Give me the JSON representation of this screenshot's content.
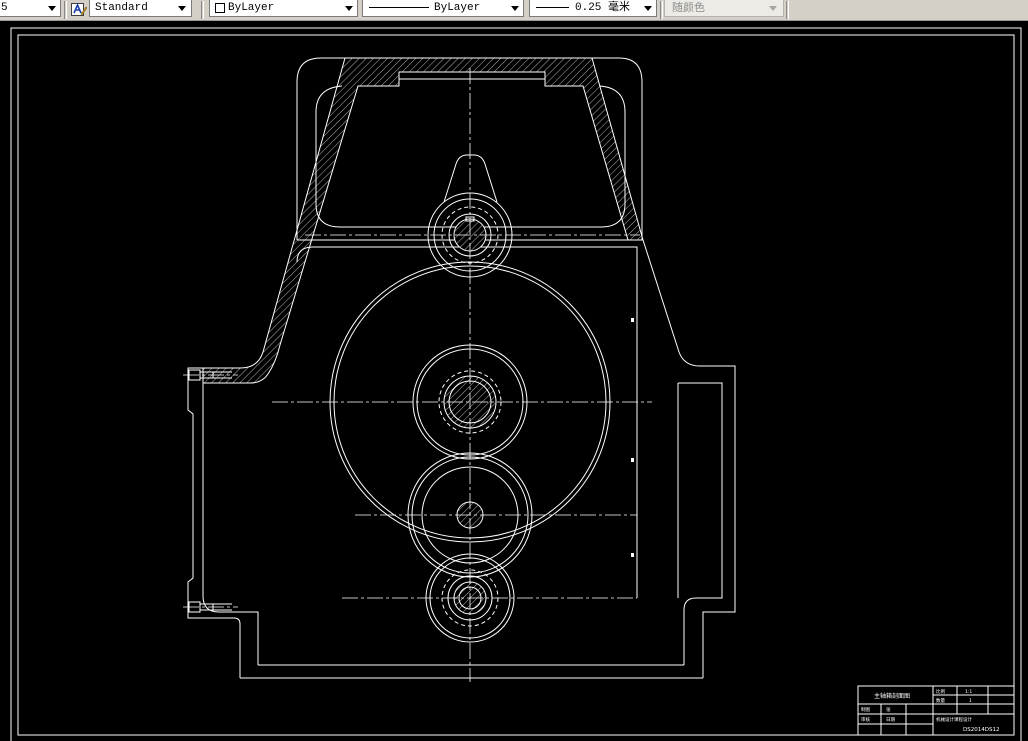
{
  "window": {
    "canvas_background": "#000000",
    "entity_color": "#ffffff",
    "toolbar_background": "#d4d0c8"
  },
  "toolbar": {
    "dim_style": {
      "value": "5"
    },
    "text_style": {
      "icon": "text-style-icon",
      "value": "Standard"
    },
    "color_control": {
      "value": "ByLayer",
      "swatch": "#ffffff"
    },
    "linetype_control": {
      "value": "ByLayer"
    },
    "lineweight_control": {
      "value": "0.25 毫米"
    },
    "plot_style_control": {
      "value": "随颜色",
      "disabled": true
    }
  },
  "title_block": {
    "drawing_title": "主轴箱剖面图",
    "scale_label": "比例",
    "scale_value": "1:1",
    "quantity_label": "数量",
    "quantity_value": "1",
    "rows": [
      {
        "label": "制图",
        "value": "张"
      },
      {
        "label": "审核",
        "value": "日期"
      }
    ],
    "institution": "机械设计课程设计",
    "drawing_number": "DS2014DS12"
  }
}
